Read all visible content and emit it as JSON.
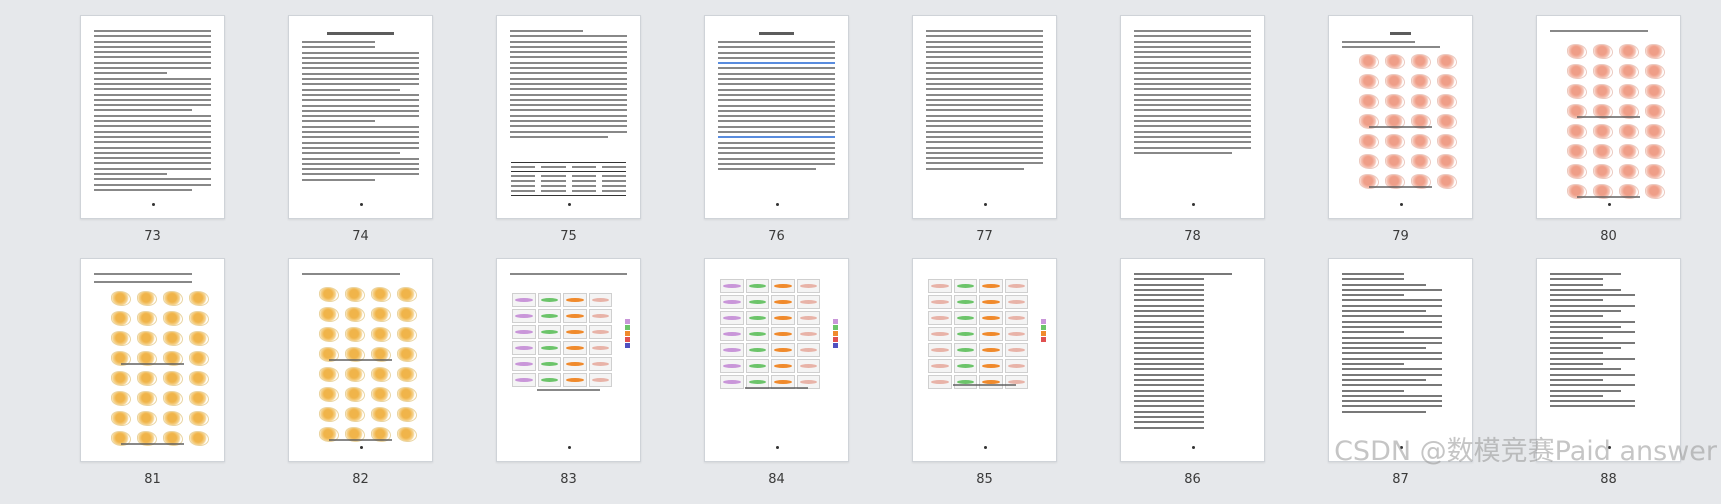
{
  "pages": [
    {
      "number": "73"
    },
    {
      "number": "74"
    },
    {
      "number": "75"
    },
    {
      "number": "76"
    },
    {
      "number": "77"
    },
    {
      "number": "78"
    },
    {
      "number": "79"
    },
    {
      "number": "80"
    },
    {
      "number": "81"
    },
    {
      "number": "82"
    },
    {
      "number": "83"
    },
    {
      "number": "84"
    },
    {
      "number": "85"
    },
    {
      "number": "86"
    },
    {
      "number": "87"
    },
    {
      "number": "88"
    }
  ],
  "watermark": "CSDN @数模竞赛Paid answer",
  "colors": {
    "background": "#e6e8eb",
    "page": "#ffffff",
    "map_fill": "#f2b27d",
    "panel_purple": "#c996d9",
    "panel_green": "#6cc46a",
    "panel_orange": "#f08a2c"
  }
}
